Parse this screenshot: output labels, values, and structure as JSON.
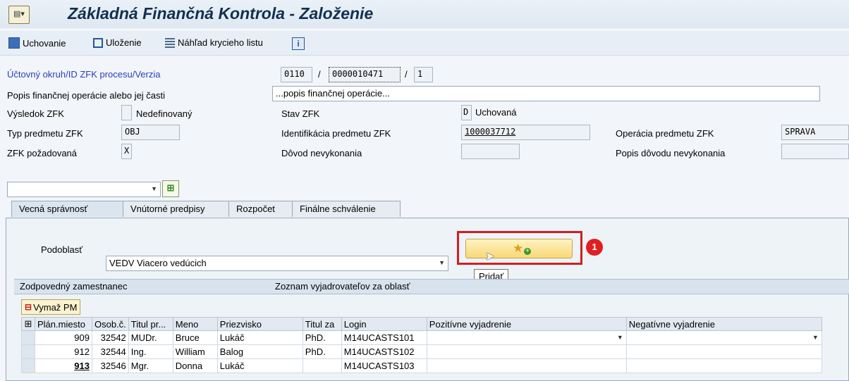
{
  "window": {
    "title": "Základná Finančná Kontrola - Založenie",
    "menu_icon": "sap-menu-icon"
  },
  "toolbar": {
    "keep": "Uchovanie",
    "save": "Uloženie",
    "preview": "Náhľad krycieho listu",
    "info": "i"
  },
  "header": {
    "area_label": "Účtovný okruh/ID ZFK procesu/Verzia",
    "area": "0110",
    "process_id": "0000010471",
    "version": "1",
    "slash": "/",
    "desc_label": "Popis finančnej operácie alebo jej časti",
    "desc_value": "...popis finančnej operácie...",
    "result_label": "Výsledok ZFK",
    "result_value": "",
    "result_text": "Nedefinovaný",
    "status_label": "Stav ZFK",
    "status_code": "D",
    "status_text": "Uchovaná",
    "subject_type_label": "Typ predmetu ZFK",
    "subject_type": "OBJ",
    "subject_id_label": "Identifikácia predmetu ZFK",
    "subject_id": "1000037712",
    "operation_label": "Operácia predmetu ZFK",
    "operation": "SPRAVA",
    "required_label": "ZFK požadovaná",
    "required": "X",
    "reason_label": "Dôvod nevykonania",
    "reason_value": "",
    "reason_desc_label": "Popis dôvodu nevykonania",
    "reason_desc_value": ""
  },
  "tabs": [
    "Vecná správnosť",
    "Vnútorné predpisy",
    "Rozpočet",
    "Finálne schválenie"
  ],
  "panel": {
    "subarea_label": "Podoblasť",
    "subarea_value": "VEDV Viacero vedúcich",
    "add_tooltip": "Pridať",
    "badge": "1",
    "responsible_label": "Zodpovedný zamestnanec",
    "list_label": "Zoznam vyjadrovateľov za oblasť",
    "delete_button": "Vymaž PM"
  },
  "table": {
    "columns": [
      "Plán.miesto",
      "Osob.č.",
      "Titul pr...",
      "Meno",
      "Priezvisko",
      "Titul za",
      "Login",
      "Pozitívne vyjadrenie",
      "Negatívne vyjadrenie"
    ],
    "rows": [
      [
        "909",
        "32542",
        "MUDr.",
        "Bruce",
        "Lukáč",
        "PhD.",
        "M14UCASTS101",
        "",
        ""
      ],
      [
        "912",
        "32544",
        "Ing.",
        "William",
        "Balog",
        "PhD.",
        "M14UCASTS102",
        "",
        ""
      ],
      [
        "913",
        "32546",
        "Mgr.",
        "Donna",
        "Lukáč",
        "",
        "M14UCASTS103",
        "",
        ""
      ]
    ]
  }
}
